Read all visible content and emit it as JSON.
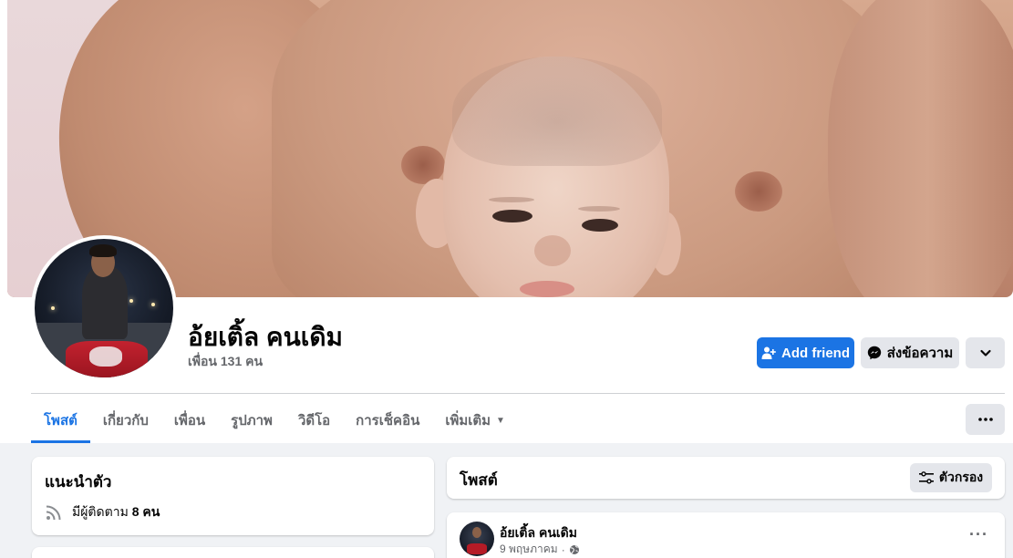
{
  "profile": {
    "name": "อ้ยเติ้ล คนเดิม",
    "friends_text": "เพื่อน 131 คน"
  },
  "actions": {
    "add_friend": "Add friend",
    "message": "ส่งข้อความ"
  },
  "tabs": [
    {
      "label": "โพสต์",
      "active": true
    },
    {
      "label": "เกี่ยวกับ"
    },
    {
      "label": "เพื่อน"
    },
    {
      "label": "รูปภาพ"
    },
    {
      "label": "วิดีโอ"
    },
    {
      "label": "การเช็คอิน"
    },
    {
      "label": "เพิ่มเติม"
    }
  ],
  "intro": {
    "title": "แนะนำตัว",
    "followers_prefix": "มีผู้ติดตาม",
    "followers_count": "8 คน"
  },
  "posts": {
    "title": "โพสต์",
    "filter_label": "ตัวกรอง"
  },
  "post": {
    "author": "อ้ยเติ้ล คนเดิม",
    "date": "9 พฤษภาคม"
  },
  "colors": {
    "accent": "#1b74e4",
    "background": "#f0f2f5",
    "secondary_button": "#e4e6eb"
  },
  "icons": {
    "add_friend": "person-add-icon",
    "message": "messenger-icon",
    "chevron": "chevron-down-icon",
    "more": "more-horizontal-icon",
    "filter": "filter-icon",
    "rss": "rss-icon",
    "privacy": "globe-icon"
  }
}
